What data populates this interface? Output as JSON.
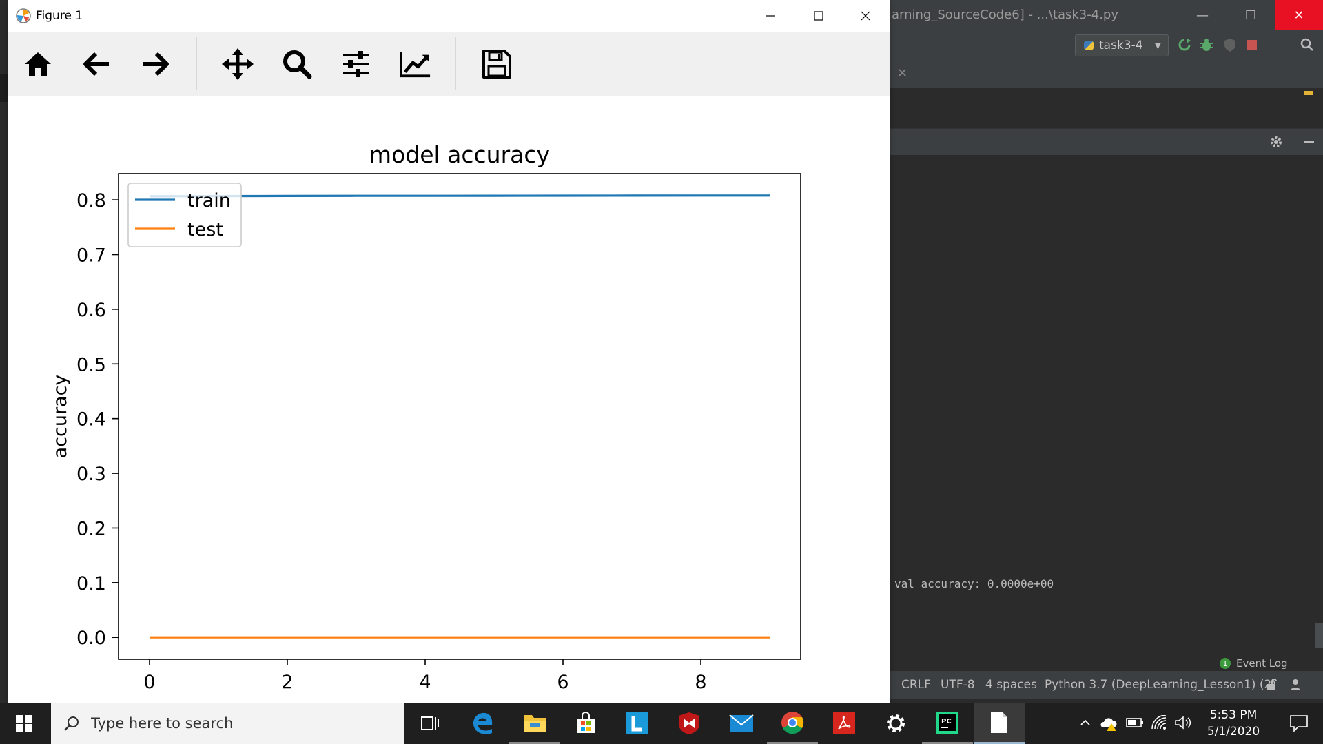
{
  "ide": {
    "title": "arning_SourceCode6] - ...\\task3-4.py",
    "run_config": "task3-4",
    "console_line": "val_accuracy: 0.0000e+00",
    "event_log": {
      "badge": "1",
      "label": "Event Log"
    },
    "status": {
      "line_sep": "CRLF",
      "encoding": "UTF-8",
      "indent": "4 spaces",
      "interpreter": "Python 3.7 (DeepLearning_Lesson1) (2)"
    }
  },
  "figure": {
    "window_title": "Figure 1",
    "toolbar": [
      "home-icon",
      "back-icon",
      "forward-icon",
      "pan-icon",
      "zoom-icon",
      "configure-icon",
      "edit-icon",
      "save-icon"
    ]
  },
  "chart_data": {
    "type": "line",
    "title": "model accuracy",
    "xlabel": "",
    "ylabel": "accuracy",
    "x": [
      0,
      1,
      2,
      3,
      4,
      5,
      6,
      7,
      8,
      9
    ],
    "series": [
      {
        "name": "train",
        "color": "#1f77b4",
        "values": [
          0.8066,
          0.807,
          0.8072,
          0.8074,
          0.8075,
          0.8076,
          0.8077,
          0.8078,
          0.8079,
          0.808
        ]
      },
      {
        "name": "test",
        "color": "#ff7f0e",
        "values": [
          0,
          0,
          0,
          0,
          0,
          0,
          0,
          0,
          0,
          0
        ]
      }
    ],
    "xlim": [
      -0.45,
      9.45
    ],
    "ylim": [
      -0.04,
      0.848
    ],
    "xticks": [
      0,
      2,
      4,
      6,
      8
    ],
    "yticks": [
      0.0,
      0.1,
      0.2,
      0.3,
      0.4,
      0.5,
      0.6,
      0.7,
      0.8
    ],
    "ytick_labels": [
      "0.0",
      "0.1",
      "0.2",
      "0.3",
      "0.4",
      "0.5",
      "0.6",
      "0.7",
      "0.8"
    ],
    "grid": false,
    "legend": "upper left"
  },
  "taskbar": {
    "search_placeholder": "Type here to search",
    "apps": [
      "task-view-icon",
      "edge-icon",
      "file-explorer-icon",
      "store-icon",
      "l-app-icon",
      "mcafee-icon",
      "mail-icon",
      "chrome-icon",
      "acrobat-icon",
      "settings-icon",
      "pycharm-icon",
      "notepad-icon"
    ],
    "time": "5:53 PM",
    "date": "5/1/2020"
  }
}
